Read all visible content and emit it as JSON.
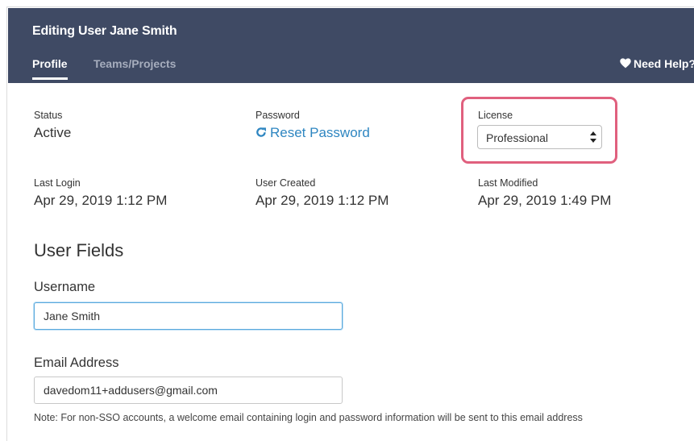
{
  "header": {
    "title": "Editing User Jane Smith",
    "tabs": [
      {
        "label": "Profile",
        "active": true
      },
      {
        "label": "Teams/Projects",
        "active": false
      }
    ],
    "help_label": "Need Help?",
    "help_icon": "heart-icon",
    "background_color": "#3f4a64"
  },
  "info": {
    "status": {
      "label": "Status",
      "value": "Active"
    },
    "password": {
      "label": "Password",
      "link_label": "Reset Password",
      "icon": "reload-icon"
    },
    "license": {
      "label": "License",
      "selected": "Professional"
    },
    "last_login": {
      "label": "Last Login",
      "value": "Apr 29, 2019 1:12 PM"
    },
    "user_created": {
      "label": "User Created",
      "value": "Apr 29, 2019 1:12 PM"
    },
    "last_modified": {
      "label": "Last Modified",
      "value": "Apr 29, 2019 1:49 PM"
    }
  },
  "user_fields": {
    "title": "User Fields",
    "username": {
      "label": "Username",
      "value": "Jane Smith"
    },
    "email": {
      "label": "Email Address",
      "value": "davedom11+addusers@gmail.com"
    },
    "note": "Note: For non-SSO accounts, a welcome email containing login and password information will be sent to this email address"
  },
  "colors": {
    "link": "#2e86c1",
    "highlight": "#e0607e",
    "focus_border": "#5aa9dd"
  }
}
